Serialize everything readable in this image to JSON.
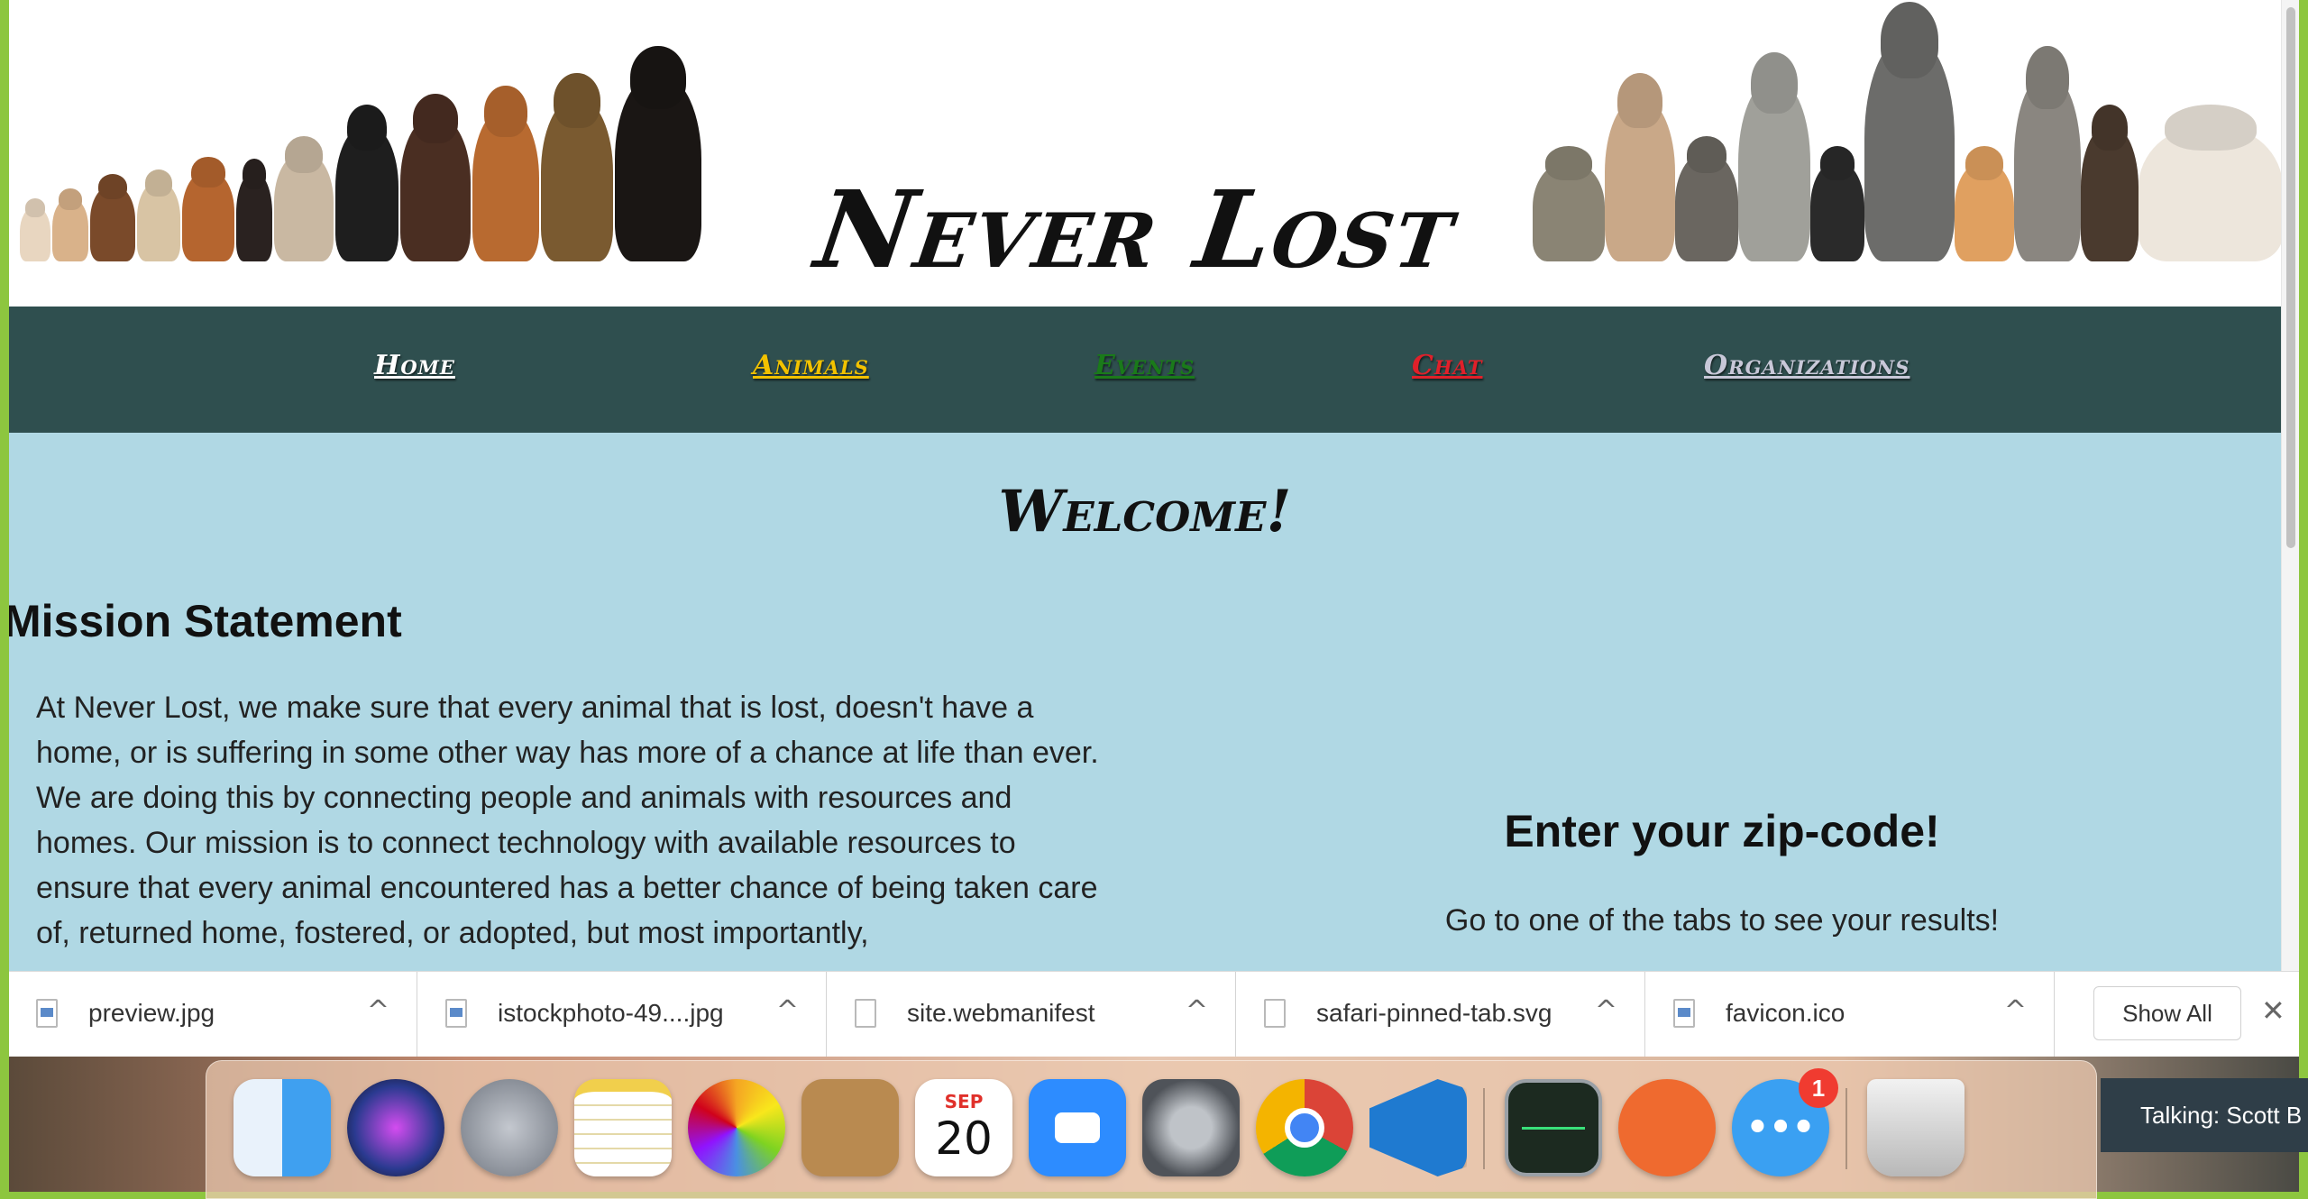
{
  "site": {
    "title": "Never Lost",
    "nav": [
      {
        "label": "Home",
        "color": "#ffffff"
      },
      {
        "label": "Animals",
        "color": "#f2c200"
      },
      {
        "label": "Events",
        "color": "#1a7a1a"
      },
      {
        "label": "Chat",
        "color": "#e0202a"
      },
      {
        "label": "Organizations",
        "color": "#c8c8d8"
      }
    ],
    "welcome": "Welcome!",
    "mission_heading": "Mission Statement",
    "mission_text": "At Never Lost, we make sure that every animal that is lost, doesn't have a home, or is suffering in some other way has more of a chance at life than ever. We are doing this by connecting people and animals with resources and homes. Our mission is to connect technology with available resources to ensure that every animal encountered has a better chance of being taken care of, returned home, fostered, or adopted, but most importantly,",
    "zip_heading": "Enter your zip-code!",
    "zip_sub": "Go to one of the tabs to see your results!"
  },
  "downloads": {
    "items": [
      {
        "name": "preview.jpg",
        "icon": "jpg-file-icon"
      },
      {
        "name": "istockphoto-49....jpg",
        "icon": "jpg-file-icon"
      },
      {
        "name": "site.webmanifest",
        "icon": "blank-file-icon"
      },
      {
        "name": "safari-pinned-tab.svg",
        "icon": "text-file-icon"
      },
      {
        "name": "favicon.ico",
        "icon": "ico-file-icon"
      }
    ],
    "chevron": "^",
    "show_all": "Show All",
    "close": "✕"
  },
  "dock": {
    "apps": [
      {
        "name": "finder-icon",
        "color": "#3fa0f0"
      },
      {
        "name": "siri-icon",
        "color": "#222a50"
      },
      {
        "name": "launchpad-icon",
        "color": "#8b9099"
      },
      {
        "name": "notes-icon",
        "color": "#f6e7a0"
      },
      {
        "name": "photos-icon",
        "color": "#ffffff"
      },
      {
        "name": "contacts-icon",
        "color": "#b98a50"
      },
      {
        "name": "calendar-icon",
        "color": "#ffffff"
      },
      {
        "name": "zoom-icon",
        "color": "#2d8cff"
      },
      {
        "name": "system-preferences-icon",
        "color": "#6b6f75"
      },
      {
        "name": "chrome-icon",
        "color": "#e8e8e8"
      },
      {
        "name": "vscode-icon",
        "color": "#1f7ad0"
      },
      {
        "name": "activity-monitor-icon",
        "color": "#1c2a20"
      },
      {
        "name": "postman-icon",
        "color": "#ef6a2f"
      },
      {
        "name": "messages-icon",
        "color": "#3aa0f2"
      },
      {
        "name": "trash-icon",
        "color": "#e4e4e4"
      }
    ],
    "calendar_month": "SEP",
    "calendar_day": "20",
    "messages_badge": "1",
    "talking": "Talking: Scott B"
  }
}
